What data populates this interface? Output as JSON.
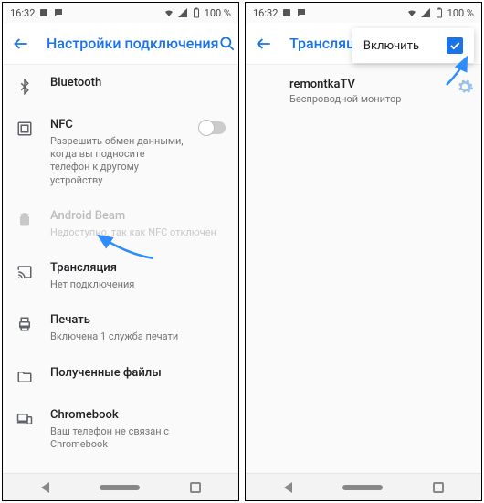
{
  "status": {
    "time": "16:32",
    "battery": "100 %"
  },
  "left": {
    "title": "Настройки подключения",
    "rows": {
      "bluetooth": {
        "title": "Bluetooth"
      },
      "nfc": {
        "title": "NFC",
        "sub": "Разрешить обмен данными, когда вы подносите телефон к другому устройству"
      },
      "beam": {
        "title": "Android Beam",
        "sub": "Недоступно, так как NFC отключен"
      },
      "cast": {
        "title": "Трансляция",
        "sub": "Нет подключения"
      },
      "print": {
        "title": "Печать",
        "sub": "Включена 1 служба печати"
      },
      "files": {
        "title": "Полученные файлы"
      },
      "chromebook": {
        "title": "Chromebook",
        "sub": "Ваш телефон не связан с Chromebook"
      }
    }
  },
  "right": {
    "title": "Трансляция",
    "popup_label": "Включить",
    "device": {
      "title": "remontkaTV",
      "sub": "Беспроводной монитор"
    }
  }
}
